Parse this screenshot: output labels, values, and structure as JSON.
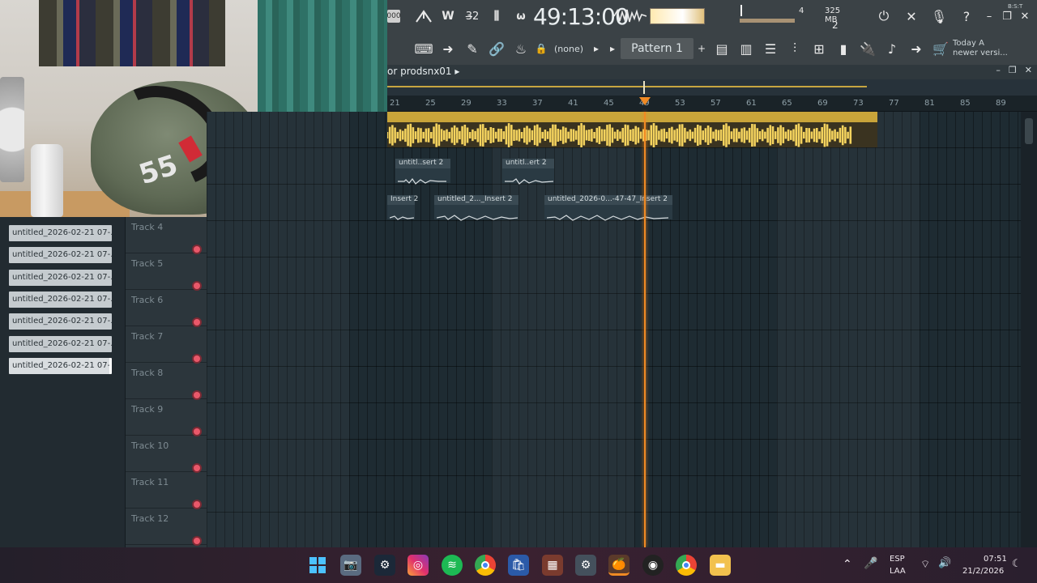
{
  "toolbar": {
    "tempo_partial": "000",
    "time": "49:13:00",
    "time_sub": "B:S:T",
    "cpu_value": "4",
    "memory": "325 MB",
    "polyphony": "2",
    "pattern": "Pattern 1",
    "channel_none": "(none)",
    "news_line1": "Today  A",
    "news_line2": "newer versi..."
  },
  "playlist": {
    "title": "or prodsnx01",
    "bars": [
      "21",
      "25",
      "29",
      "33",
      "37",
      "41",
      "45",
      "49",
      "53",
      "57",
      "61",
      "65",
      "69",
      "73",
      "77",
      "81",
      "85",
      "89"
    ]
  },
  "clips": {
    "row2": [
      {
        "label": "untitl..sert 2"
      },
      {
        "label": "untitl..ert 2"
      }
    ],
    "row3": [
      {
        "label": "Insert 2"
      },
      {
        "label": "untitled_2..._Insert 2"
      },
      {
        "label": "untitled_2026-0...-47-47_Insert 2"
      }
    ]
  },
  "picker": {
    "items": [
      "untitled_2026-02-21 07-...",
      "untitled_2026-02-21 07-...",
      "untitled_2026-02-21 07-...",
      "untitled_2026-02-21 07-...",
      "untitled_2026-02-21 07-...",
      "untitled_2026-02-21 07-...",
      "untitled_2026-02-21 07-..."
    ]
  },
  "tracks": [
    "Track 4",
    "Track 5",
    "Track 6",
    "Track 7",
    "Track 8",
    "Track 9",
    "Track 10",
    "Track 11",
    "Track 12"
  ],
  "webcam": {
    "cap_text": "55"
  },
  "taskbar": {
    "language_line1": "ESP",
    "language_line2": "LAA",
    "clock_time": "07:51",
    "clock_date": "21/2/2026"
  },
  "colors": {
    "accent_orange": "#f08a24",
    "clip_gold": "#c8a43a",
    "wave_yellow": "#f4d35e"
  }
}
